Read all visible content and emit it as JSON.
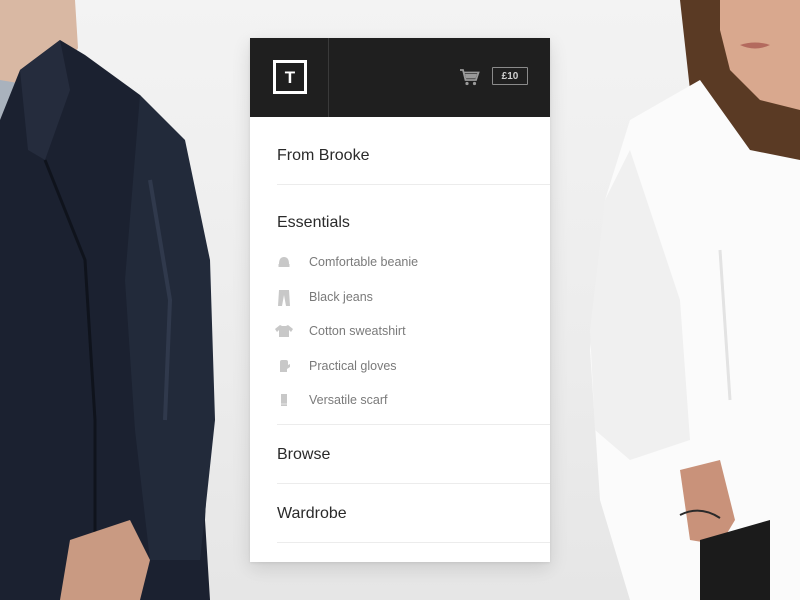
{
  "header": {
    "logo_letter": "T",
    "cart_icon": "cart-icon",
    "cart_total": "£10"
  },
  "menu": {
    "from_brooke": "From Brooke",
    "essentials": {
      "label": "Essentials",
      "items": [
        {
          "label": "Comfortable beanie",
          "icon": "beanie-icon"
        },
        {
          "label": "Black jeans",
          "icon": "jeans-icon"
        },
        {
          "label": "Cotton sweatshirt",
          "icon": "sweatshirt-icon"
        },
        {
          "label": "Practical gloves",
          "icon": "glove-icon"
        },
        {
          "label": "Versatile scarf",
          "icon": "scarf-icon"
        }
      ]
    },
    "browse": "Browse",
    "wardrobe": "Wardrobe"
  },
  "colors": {
    "topbar": "#1f1f1f",
    "icon_gray": "#c8c8c8",
    "sub_text": "#7a7a7a"
  }
}
